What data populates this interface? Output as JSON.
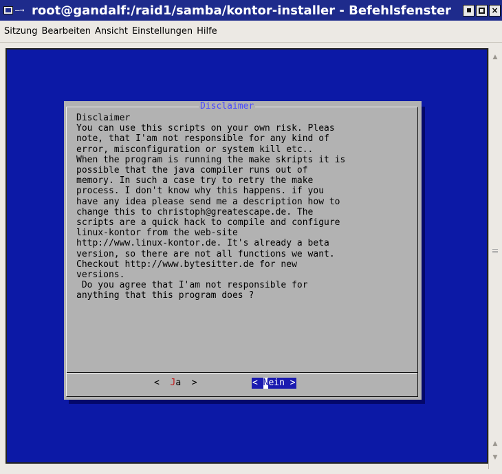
{
  "window": {
    "title": "root@gandalf:/raid1/samba/kontor-installer - Befehlsfenster",
    "term_glyph": "—→",
    "buttons": {
      "minimize": "",
      "maximize": "",
      "close": "×"
    }
  },
  "menubar": {
    "items": [
      "Sitzung",
      "Bearbeiten",
      "Ansicht",
      "Einstellungen",
      "Hilfe"
    ]
  },
  "dialog": {
    "title": "Disclaimer",
    "text": "Disclaimer\nYou can use this scripts on your own risk. Pleas\nnote, that I'am not responsible for any kind of\nerror, misconfiguration or system kill etc..\nWhen the program is running the make skripts it is\npossible that the java compiler runs out of\nmemory. In such a case try to retry the make\nprocess. I don't know why this happens. if you\nhave any idea please send me a description how to\nchange this to christoph@greatescape.de. The\nscripts are a quick hack to compile and configure\nlinux-kontor from the web-site\nhttp://www.linux-kontor.de. It's already a beta\nversion, so there are not all functions we want.\nCheckout http://www.bytesitter.de for new\nversions.\n Do you agree that I'am not responsible for\nanything that this program does ?",
    "yes": {
      "left": "<  ",
      "hotkey": "J",
      "rest": "a",
      "right": "  >"
    },
    "no": {
      "left": "< ",
      "cursor": "N",
      "rest": "ein",
      "right": " >"
    }
  },
  "colors": {
    "terminal_bg": "#0c19a6",
    "dialog_bg": "#b2b2b2",
    "title_bar": "#1e2b8c",
    "hotkey": "#c01818",
    "selected_button_bg": "#1a1ab0"
  }
}
